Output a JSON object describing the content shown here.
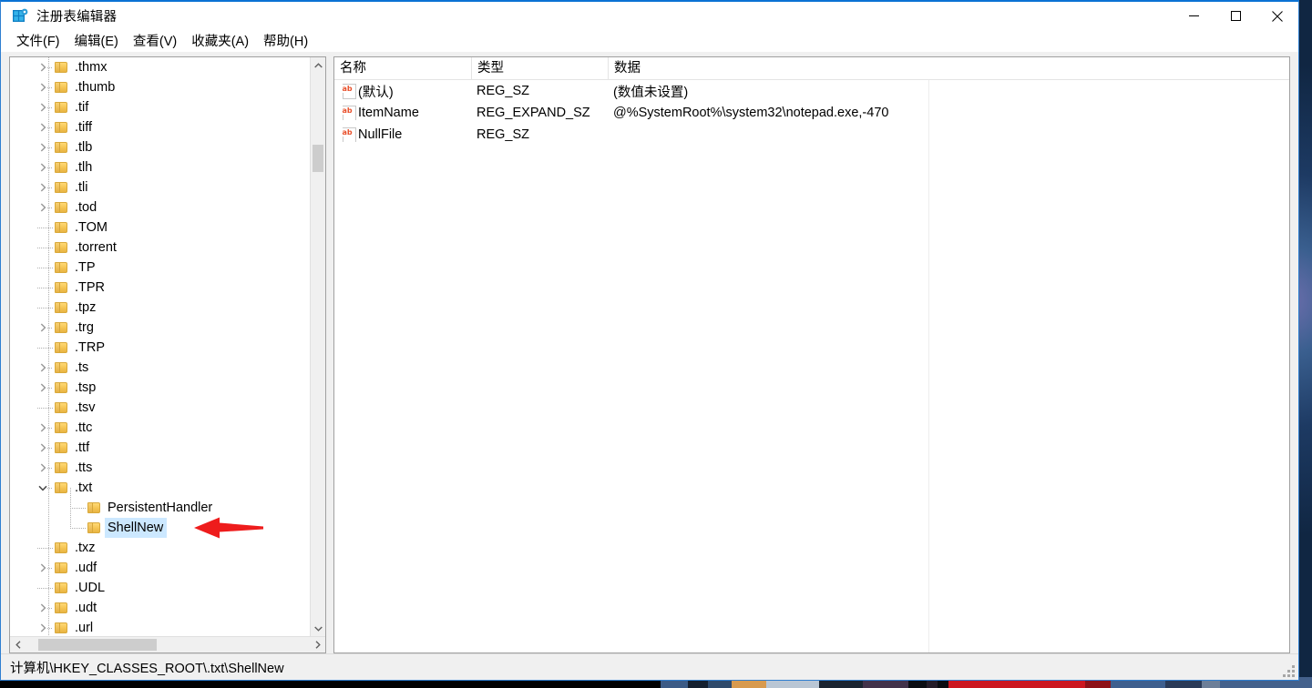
{
  "window": {
    "title": "注册表编辑器",
    "app_icon": "registry-editor-icon",
    "controls": {
      "minimize": "—",
      "maximize": "☐",
      "close": "✕"
    }
  },
  "menubar": {
    "items": [
      {
        "label": "文件(F)",
        "name": "menu-file"
      },
      {
        "label": "编辑(E)",
        "name": "menu-edit"
      },
      {
        "label": "查看(V)",
        "name": "menu-view"
      },
      {
        "label": "收藏夹(A)",
        "name": "menu-favorites"
      },
      {
        "label": "帮助(H)",
        "name": "menu-help"
      }
    ]
  },
  "tree": {
    "rows": [
      {
        "label": ".thmx",
        "depth": 1,
        "expandable": true,
        "expanded": false,
        "selected": false
      },
      {
        "label": ".thumb",
        "depth": 1,
        "expandable": true,
        "expanded": false,
        "selected": false
      },
      {
        "label": ".tif",
        "depth": 1,
        "expandable": true,
        "expanded": false,
        "selected": false
      },
      {
        "label": ".tiff",
        "depth": 1,
        "expandable": true,
        "expanded": false,
        "selected": false
      },
      {
        "label": ".tlb",
        "depth": 1,
        "expandable": true,
        "expanded": false,
        "selected": false
      },
      {
        "label": ".tlh",
        "depth": 1,
        "expandable": true,
        "expanded": false,
        "selected": false
      },
      {
        "label": ".tli",
        "depth": 1,
        "expandable": true,
        "expanded": false,
        "selected": false
      },
      {
        "label": ".tod",
        "depth": 1,
        "expandable": true,
        "expanded": false,
        "selected": false
      },
      {
        "label": ".TOM",
        "depth": 1,
        "expandable": false,
        "expanded": false,
        "selected": false
      },
      {
        "label": ".torrent",
        "depth": 1,
        "expandable": false,
        "expanded": false,
        "selected": false
      },
      {
        "label": ".TP",
        "depth": 1,
        "expandable": false,
        "expanded": false,
        "selected": false
      },
      {
        "label": ".TPR",
        "depth": 1,
        "expandable": false,
        "expanded": false,
        "selected": false
      },
      {
        "label": ".tpz",
        "depth": 1,
        "expandable": false,
        "expanded": false,
        "selected": false
      },
      {
        "label": ".trg",
        "depth": 1,
        "expandable": true,
        "expanded": false,
        "selected": false
      },
      {
        "label": ".TRP",
        "depth": 1,
        "expandable": false,
        "expanded": false,
        "selected": false
      },
      {
        "label": ".ts",
        "depth": 1,
        "expandable": true,
        "expanded": false,
        "selected": false
      },
      {
        "label": ".tsp",
        "depth": 1,
        "expandable": true,
        "expanded": false,
        "selected": false
      },
      {
        "label": ".tsv",
        "depth": 1,
        "expandable": false,
        "expanded": false,
        "selected": false
      },
      {
        "label": ".ttc",
        "depth": 1,
        "expandable": true,
        "expanded": false,
        "selected": false
      },
      {
        "label": ".ttf",
        "depth": 1,
        "expandable": true,
        "expanded": false,
        "selected": false
      },
      {
        "label": ".tts",
        "depth": 1,
        "expandable": true,
        "expanded": false,
        "selected": false
      },
      {
        "label": ".txt",
        "depth": 1,
        "expandable": true,
        "expanded": true,
        "selected": false
      },
      {
        "label": "PersistentHandler",
        "depth": 2,
        "expandable": false,
        "expanded": false,
        "selected": false
      },
      {
        "label": "ShellNew",
        "depth": 2,
        "expandable": false,
        "expanded": false,
        "selected": true
      },
      {
        "label": ".txz",
        "depth": 1,
        "expandable": false,
        "expanded": false,
        "selected": false
      },
      {
        "label": ".udf",
        "depth": 1,
        "expandable": true,
        "expanded": false,
        "selected": false
      },
      {
        "label": ".UDL",
        "depth": 1,
        "expandable": false,
        "expanded": false,
        "selected": false
      },
      {
        "label": ".udt",
        "depth": 1,
        "expandable": true,
        "expanded": false,
        "selected": false
      },
      {
        "label": ".url",
        "depth": 1,
        "expandable": true,
        "expanded": false,
        "selected": false
      }
    ],
    "scroll_up_icon": "chevron-up-icon",
    "scroll_down_icon": "chevron-down-icon",
    "scroll_left_icon": "chevron-left-icon",
    "scroll_right_icon": "chevron-right-icon"
  },
  "annotation": {
    "type": "arrow-pointing-left",
    "color": "#ee1c1c",
    "target": "ShellNew"
  },
  "values": {
    "columns": [
      {
        "label": "名称",
        "name": "column-name"
      },
      {
        "label": "类型",
        "name": "column-type"
      },
      {
        "label": "数据",
        "name": "column-data"
      }
    ],
    "rows": [
      {
        "icon": "string-value-icon",
        "name": "(默认)",
        "type": "REG_SZ",
        "data": "(数值未设置)"
      },
      {
        "icon": "string-value-icon",
        "name": "ItemName",
        "type": "REG_EXPAND_SZ",
        "data": "@%SystemRoot%\\system32\\notepad.exe,-470"
      },
      {
        "icon": "string-value-icon",
        "name": "NullFile",
        "type": "REG_SZ",
        "data": ""
      }
    ],
    "icon_text": "ab"
  },
  "statusbar": {
    "path": "计算机\\HKEY_CLASSES_ROOT\\.txt\\ShellNew"
  },
  "colors": {
    "selection": "#cce8ff",
    "accent_border": "#0a72d4",
    "folder": "#f5c452",
    "annotation_red": "#ee1c1c"
  }
}
